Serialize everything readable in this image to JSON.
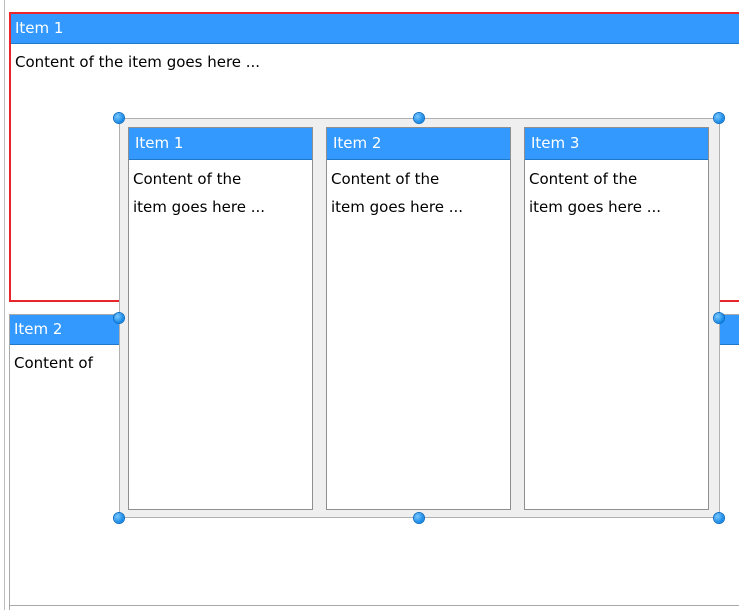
{
  "outer_items": [
    {
      "title": "Item 1",
      "content": "Content of the item goes here ..."
    },
    {
      "title": "Item 2",
      "content": "Content of"
    }
  ],
  "overlay_items": [
    {
      "title": "Item 1",
      "content": "Content of the\nitem goes here ..."
    },
    {
      "title": "Item 2",
      "content": "Content of the\nitem goes here ..."
    },
    {
      "title": "Item 3",
      "content": "Content of the\nitem goes here ..."
    }
  ],
  "colors": {
    "header_bg": "#3399ff",
    "header_text": "#ffffff",
    "selection_border": "#e8262b",
    "handle": "#1287e6"
  },
  "icons": [
    "resize-handle-icon"
  ]
}
